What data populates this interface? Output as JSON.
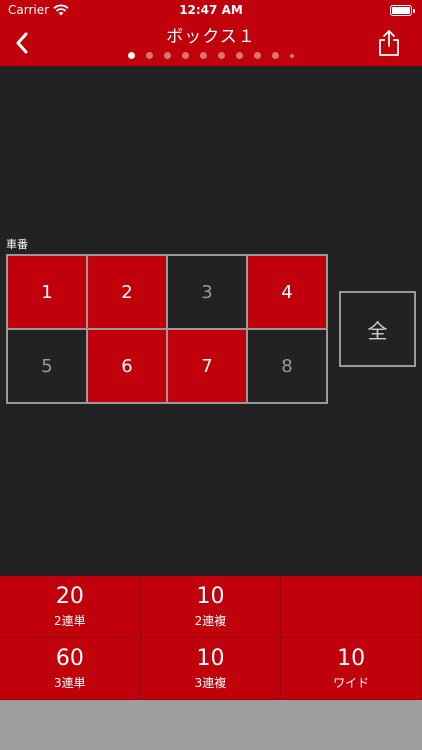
{
  "status_bar": {
    "carrier": "Carrier",
    "time": "12:47 AM"
  },
  "nav": {
    "title": "ボックス１",
    "page_count": 10,
    "active_page": 0
  },
  "grid": {
    "label": "車番",
    "cells": [
      {
        "label": "1",
        "selected": true
      },
      {
        "label": "2",
        "selected": true
      },
      {
        "label": "3",
        "selected": false
      },
      {
        "label": "4",
        "selected": true
      },
      {
        "label": "5",
        "selected": false
      },
      {
        "label": "6",
        "selected": true
      },
      {
        "label": "7",
        "selected": true
      },
      {
        "label": "8",
        "selected": false
      }
    ],
    "all_label": "全"
  },
  "summary": {
    "items": [
      {
        "value": "20",
        "label": "2連単"
      },
      {
        "value": "10",
        "label": "2連複"
      },
      {
        "value": "",
        "label": ""
      },
      {
        "value": "60",
        "label": "3連単"
      },
      {
        "value": "10",
        "label": "3連複"
      },
      {
        "value": "10",
        "label": "ワイド"
      }
    ]
  },
  "colors": {
    "accent": "#c0000b",
    "background": "#222222",
    "footer": "#9e9e9e"
  }
}
